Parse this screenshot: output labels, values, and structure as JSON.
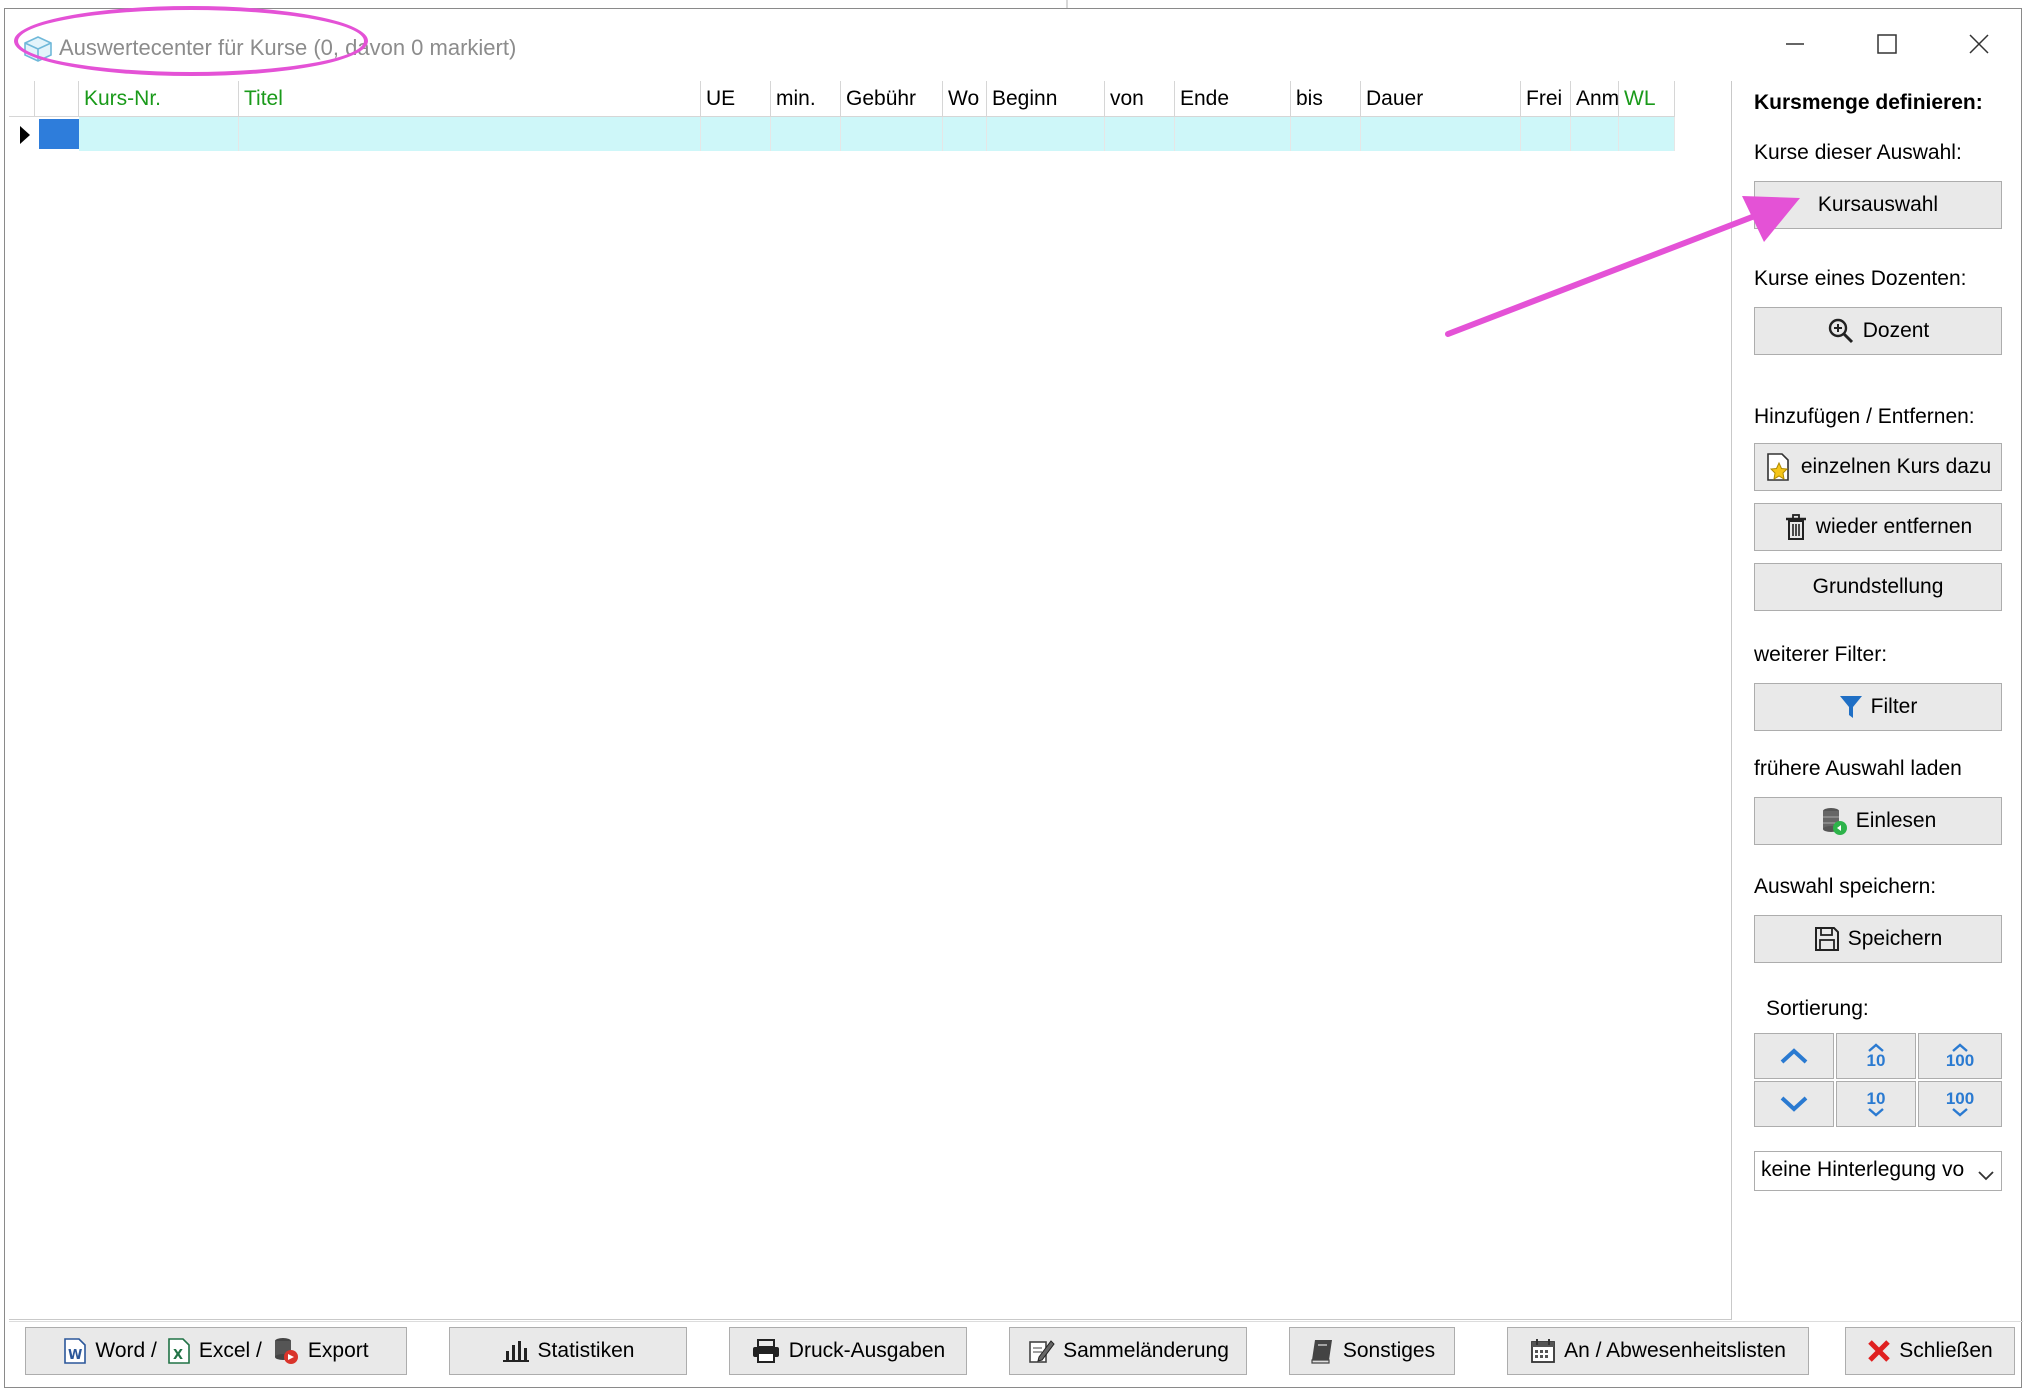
{
  "window": {
    "title": "Auswertecenter für Kurse (0, davon 0 markiert)"
  },
  "grid": {
    "columns": [
      {
        "label": "Kurs-Nr.",
        "color": "#1a9a1a"
      },
      {
        "label": "Titel",
        "color": "#1a9a1a"
      },
      {
        "label": "UE",
        "color": "#000000"
      },
      {
        "label": "min.",
        "color": "#000000"
      },
      {
        "label": "Gebühr",
        "color": "#000000"
      },
      {
        "label": "Wo",
        "color": "#000000"
      },
      {
        "label": "Beginn",
        "color": "#000000"
      },
      {
        "label": "von",
        "color": "#000000"
      },
      {
        "label": "Ende",
        "color": "#000000"
      },
      {
        "label": "bis",
        "color": "#000000"
      },
      {
        "label": "Dauer",
        "color": "#000000"
      },
      {
        "label": "Frei",
        "color": "#000000"
      },
      {
        "label": "Anm",
        "color": "#000000"
      },
      {
        "label": "WL",
        "color": "#1a9a1a"
      }
    ],
    "row_color": "#cef7f9",
    "selection_color": "#2e7ddb"
  },
  "panel": {
    "heading": "Kursmenge definieren:",
    "sel_label": "Kurse dieser Auswahl:",
    "sel_button": "Kursauswahl",
    "doz_label": "Kurse eines Dozenten:",
    "doz_button": "Dozent",
    "add_label": "Hinzufügen / Entfernen:",
    "add_button": "einzelnen Kurs dazu",
    "remove_button": "wieder entfernen",
    "reset_button": "Grundstellung",
    "filter_label": "weiterer Filter:",
    "filter_button": "Filter",
    "load_label": "frühere Auswahl laden",
    "load_button": "Einlesen",
    "save_label": "Auswahl speichern:",
    "save_button": "Speichern",
    "sort_label": "Sortierung:",
    "sort_10": "10",
    "sort_100": "100",
    "combo_value": "keine Hinterlegung vo"
  },
  "footer": {
    "word": "Word /",
    "excel": "Excel /",
    "export": "Export",
    "stats": "Statistiken",
    "print": "Druck-Ausgaben",
    "bulk": "Sammeländerung",
    "misc": "Sonstiges",
    "attendance": "An / Abwesenheitslisten",
    "close": "Schließen"
  },
  "annotations": {
    "highlight_color": "#e452d6"
  },
  "icons": [
    "app-cube-icon",
    "minimize-icon",
    "maximize-icon",
    "close-icon",
    "row-pointer-icon",
    "zoom-icon",
    "add-course-icon",
    "trash-icon",
    "funnel-icon",
    "database-load-icon",
    "floppy-disk-icon",
    "chevron-up-icon",
    "chevron-down-icon",
    "word-icon",
    "excel-icon",
    "export-icon",
    "bar-chart-icon",
    "printer-icon",
    "edit-icon",
    "book-icon",
    "calendar-icon",
    "red-x-icon"
  ]
}
